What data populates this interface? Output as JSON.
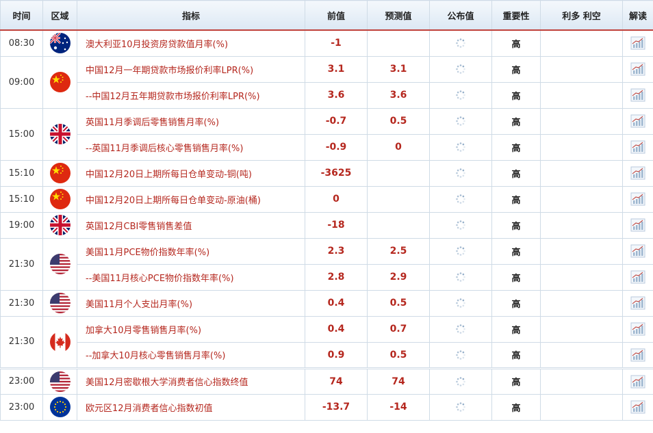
{
  "headers": {
    "time": "时间",
    "region": "区域",
    "indicator": "指标",
    "previous": "前值",
    "forecast": "预测值",
    "actual": "公布值",
    "importance": "重要性",
    "bull_bear": "利多 利空",
    "interpret": "解读"
  },
  "rows": [
    {
      "time": "08:30",
      "flag": "australia-flag-icon",
      "indicator": "澳大利亚10月投资房贷款值月率(%)",
      "previous": "-1",
      "forecast": "",
      "importance": "高"
    },
    {
      "time": "09:00",
      "flag": "china-flag-icon",
      "indicator": "中国12月一年期贷款市场报价利率LPR(%)",
      "previous": "3.1",
      "forecast": "3.1",
      "importance": "高"
    },
    {
      "time": "",
      "flag": "",
      "indicator": "--中国12月五年期贷款市场报价利率LPR(%)",
      "previous": "3.6",
      "forecast": "3.6",
      "importance": "高"
    },
    {
      "time": "15:00",
      "flag": "uk-flag-icon",
      "indicator": "英国11月季调后零售销售月率(%)",
      "previous": "-0.7",
      "forecast": "0.5",
      "importance": "高"
    },
    {
      "time": "",
      "flag": "",
      "indicator": "--英国11月季调后核心零售销售月率(%)",
      "previous": "-0.9",
      "forecast": "0",
      "importance": "高"
    },
    {
      "time": "15:10",
      "flag": "china-flag-icon",
      "indicator": "中国12月20日上期所每日仓单变动-铜(吨)",
      "previous": "-3625",
      "forecast": "",
      "importance": "高"
    },
    {
      "time": "15:10",
      "flag": "china-flag-icon",
      "indicator": "中国12月20日上期所每日仓单变动-原油(桶)",
      "previous": "0",
      "forecast": "",
      "importance": "高"
    },
    {
      "time": "19:00",
      "flag": "uk-flag-icon",
      "indicator": "英国12月CBI零售销售差值",
      "previous": "-18",
      "forecast": "",
      "importance": "高"
    },
    {
      "time": "21:30",
      "flag": "usa-flag-icon",
      "indicator": "美国11月PCE物价指数年率(%)",
      "previous": "2.3",
      "forecast": "2.5",
      "importance": "高"
    },
    {
      "time": "",
      "flag": "",
      "indicator": "--美国11月核心PCE物价指数年率(%)",
      "previous": "2.8",
      "forecast": "2.9",
      "importance": "高"
    },
    {
      "time": "21:30",
      "flag": "usa-flag-icon",
      "indicator": "美国11月个人支出月率(%)",
      "previous": "0.4",
      "forecast": "0.5",
      "importance": "高"
    },
    {
      "time": "21:30",
      "flag": "canada-flag-icon",
      "indicator": "加拿大10月零售销售月率(%)",
      "previous": "0.4",
      "forecast": "0.7",
      "importance": "高"
    },
    {
      "time": "",
      "flag": "",
      "indicator": "--加拿大10月核心零售销售月率(%)",
      "previous": "0.9",
      "forecast": "0.5",
      "importance": "高"
    },
    {
      "time": "23:00",
      "flag": "usa-flag-icon",
      "indicator": "美国12月密歇根大学消费者信心指数终值",
      "previous": "74",
      "forecast": "74",
      "importance": "高"
    },
    {
      "time": "23:00",
      "flag": "eu-flag-icon",
      "indicator": "欧元区12月消费者信心指数初值",
      "previous": "-13.7",
      "forecast": "-14",
      "importance": "高"
    }
  ],
  "colors": {
    "indicator_text": "#b5271e",
    "header_rule": "#c0413a",
    "grid": "#cfdbe6"
  }
}
